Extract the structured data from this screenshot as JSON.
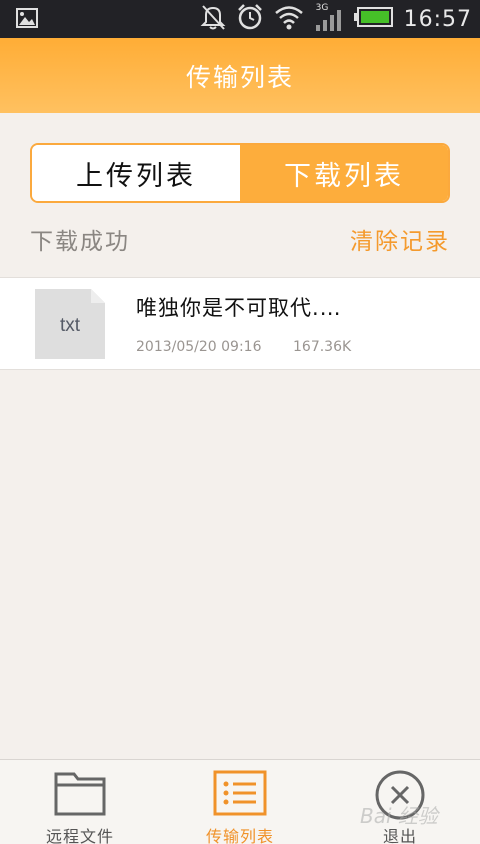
{
  "status_bar": {
    "time": "16:57",
    "network_label": "3G",
    "icons": [
      "gallery-icon",
      "bell-off-icon",
      "alarm-icon",
      "wifi-icon",
      "signal-icon",
      "battery-icon"
    ]
  },
  "header": {
    "title": "传输列表"
  },
  "tabs": {
    "upload_label": "上传列表",
    "download_label": "下载列表",
    "active": "download"
  },
  "section": {
    "title": "下载成功",
    "clear_label": "清除记录"
  },
  "files": [
    {
      "type_label": "txt",
      "name": "唯独你是不可取代.…",
      "date": "2013/05/20 09:16",
      "size": "167.36K"
    }
  ],
  "bottom_nav": {
    "remote_label": "远程文件",
    "transfer_label": "传输列表",
    "exit_label": "退出",
    "active": "transfer"
  },
  "watermark": "Bai 经验",
  "colors": {
    "accent": "#fdad3c",
    "accent_text": "#f49a2d",
    "background": "#f4f0ec",
    "status_bar": "#222226"
  }
}
